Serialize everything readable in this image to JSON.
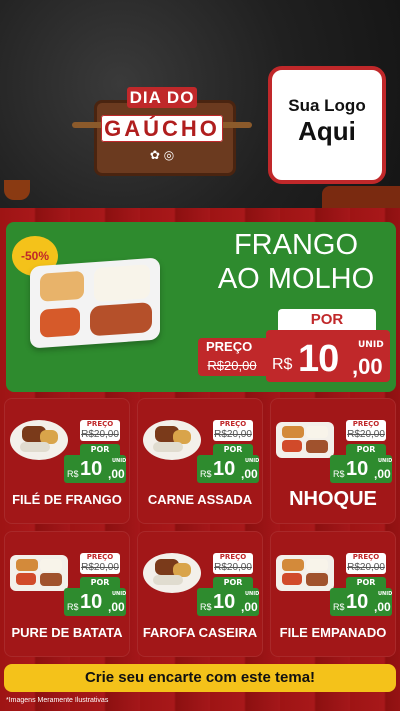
{
  "brand": {
    "title_line1": "DIA DO",
    "title_line2": "GAÚCHO",
    "colors": {
      "red": "#c0282a",
      "green": "#2e8b2e",
      "yellow": "#f4c21a",
      "dark": "#1e1e1e"
    }
  },
  "logo": {
    "line1": "Sua Logo",
    "line2": "Aqui"
  },
  "hero": {
    "discount": "-50%",
    "title_line1": "FRANGO",
    "title_line2": "AO MOLHO",
    "preco_label": "PREÇO",
    "old_price": "R$20,00",
    "por_label": "POR",
    "currency": "R$",
    "price_int": "10",
    "price_cents": ",00",
    "unit": "UNID"
  },
  "products": [
    {
      "name": "FILÉ DE FRANGO",
      "preco_label": "PREÇO",
      "old_price": "R$20,00",
      "por_label": "POR",
      "currency": "R$",
      "price_int": "10",
      "price_cents": ",00",
      "unit": "UNID",
      "icon": "plate-icon"
    },
    {
      "name": "CARNE ASSADA",
      "preco_label": "PREÇO",
      "old_price": "R$20,00",
      "por_label": "POR",
      "currency": "R$",
      "price_int": "10",
      "price_cents": ",00",
      "unit": "UNID",
      "icon": "plate-icon"
    },
    {
      "name": "NHOQUE",
      "preco_label": "PREÇO",
      "old_price": "R$20,00",
      "por_label": "POR",
      "currency": "R$",
      "price_int": "10",
      "price_cents": ",00",
      "unit": "UNID",
      "icon": "tray-icon"
    },
    {
      "name": "PURE DE BATATA",
      "preco_label": "PREÇO",
      "old_price": "R$20,00",
      "por_label": "POR",
      "currency": "R$",
      "price_int": "10",
      "price_cents": ",00",
      "unit": "UNID",
      "icon": "tray-icon"
    },
    {
      "name": "FAROFA CASEIRA",
      "preco_label": "PREÇO",
      "old_price": "R$20,00",
      "por_label": "POR",
      "currency": "R$",
      "price_int": "10",
      "price_cents": ",00",
      "unit": "UNID",
      "icon": "plate-icon"
    },
    {
      "name": "FILE EMPANADO",
      "preco_label": "PREÇO",
      "old_price": "R$20,00",
      "por_label": "POR",
      "currency": "R$",
      "price_int": "10",
      "price_cents": ",00",
      "unit": "UNID",
      "icon": "tray-icon"
    }
  ],
  "cta": {
    "label": "Crie seu encarte com este tema!"
  },
  "footnote": "*Imagens Meramente Ilustrativas"
}
